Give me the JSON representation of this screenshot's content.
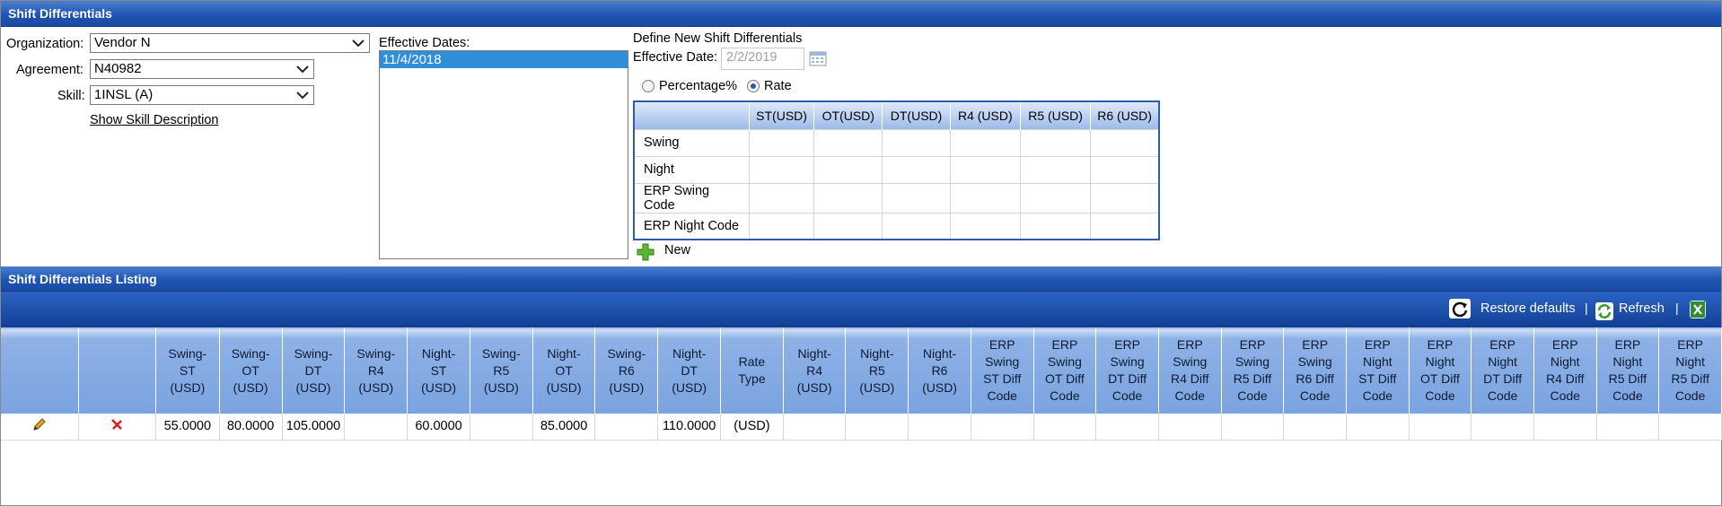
{
  "panel_title": "Shift Differentials",
  "form": {
    "organization_label": "Organization:",
    "organization_value": "Vendor N",
    "agreement_label": "Agreement:",
    "agreement_value": "N40982",
    "skill_label": "Skill:",
    "skill_value": "1INSL (A)",
    "show_skill_link": "Show Skill Description"
  },
  "effective_dates": {
    "label": "Effective Dates:",
    "items": [
      "11/4/2018"
    ]
  },
  "define_new": {
    "heading": "Define New Shift Differentials",
    "effective_date_label": "Effective Date:",
    "effective_date_placeholder": "2/2/2019",
    "radio_percentage": "Percentage%",
    "radio_rate": "Rate",
    "selected_mode": "Rate",
    "columns": [
      "",
      "ST(USD)",
      "OT(USD)",
      "DT(USD)",
      "R4 (USD)",
      "R5 (USD)",
      "R6 (USD)"
    ],
    "rows": [
      "Swing",
      "Night",
      "ERP Swing Code",
      "ERP Night Code"
    ],
    "new_label": "New"
  },
  "listing": {
    "title": "Shift Differentials Listing",
    "toolbar": {
      "restore_label": "Restore defaults",
      "refresh_label": "Refresh",
      "separator": "|"
    },
    "columns": [
      "",
      "",
      "Swing-\nST\n(USD)",
      "Swing-\nOT\n(USD)",
      "Swing-\nDT\n(USD)",
      "Swing-\nR4\n(USD)",
      "Night-\nST\n(USD)",
      "Swing-\nR5\n(USD)",
      "Night-\nOT\n(USD)",
      "Swing-\nR6\n(USD)",
      "Night-\nDT\n(USD)",
      "Rate\nType",
      "Night-\nR4\n(USD)",
      "Night-\nR5\n(USD)",
      "Night-\nR6\n(USD)",
      "ERP\nSwing\nST Diff\nCode",
      "ERP\nSwing\nOT Diff\nCode",
      "ERP\nSwing\nDT Diff\nCode",
      "ERP\nSwing\nR4 Diff\nCode",
      "ERP\nSwing\nR5 Diff\nCode",
      "ERP\nSwing\nR6 Diff\nCode",
      "ERP\nNight\nST Diff\nCode",
      "ERP\nNight\nOT Diff\nCode",
      "ERP\nNight\nDT Diff\nCode",
      "ERP\nNight\nR4 Diff\nCode",
      "ERP\nNight\nR5 Diff\nCode",
      "ERP\nNight\nR5 Diff\nCode"
    ],
    "rows": [
      [
        "",
        "",
        "55.0000",
        "80.0000",
        "105.0000",
        "",
        "60.0000",
        "",
        "85.0000",
        "",
        "110.0000",
        "(USD)",
        "",
        "",
        "",
        "",
        "",
        "",
        "",
        "",
        "",
        "",
        "",
        "",
        "",
        "",
        ""
      ]
    ]
  },
  "colors": {
    "header_blue": "#1f55b3",
    "selection_blue": "#2f8fdb",
    "grid_header": "#7aa3e0"
  }
}
